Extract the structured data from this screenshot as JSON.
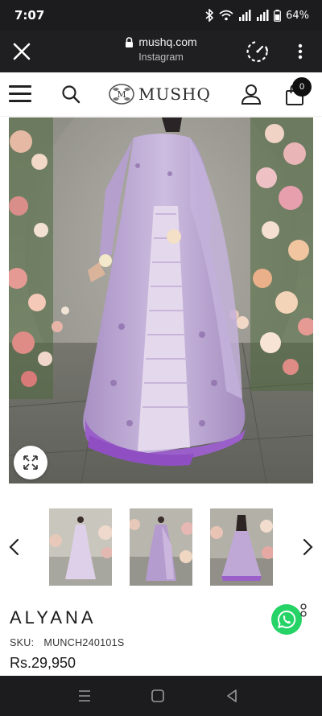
{
  "status_bar": {
    "time": "7:07",
    "battery": "64%",
    "icons": [
      "bluetooth-icon",
      "wifi-icon",
      "signal-icon",
      "signal-icon",
      "battery-icon"
    ]
  },
  "browser": {
    "url": "mushq.com",
    "subtitle": "Instagram",
    "icons": [
      "close-icon",
      "lock-icon",
      "speed-icon",
      "more-vert-icon"
    ]
  },
  "site_header": {
    "logo_text": "MUSHQ",
    "cart_count": "0",
    "icons": [
      "menu-icon",
      "search-icon",
      "user-icon",
      "shopping-bag-icon"
    ]
  },
  "product": {
    "name": "ALYANA",
    "sku_label": "SKU:",
    "sku_value": "MUNCH240101S",
    "price": "Rs.29,950"
  },
  "gallery": {
    "thumbnails": [
      "thumbnail-front-view",
      "thumbnail-dupatta-view",
      "thumbnail-back-view"
    ]
  },
  "colors": {
    "dress_lilac": "#b9a4cf",
    "dress_purple": "#9b5fc9",
    "whatsapp_green": "#25d366",
    "dark_bar": "#1c1c1e"
  }
}
